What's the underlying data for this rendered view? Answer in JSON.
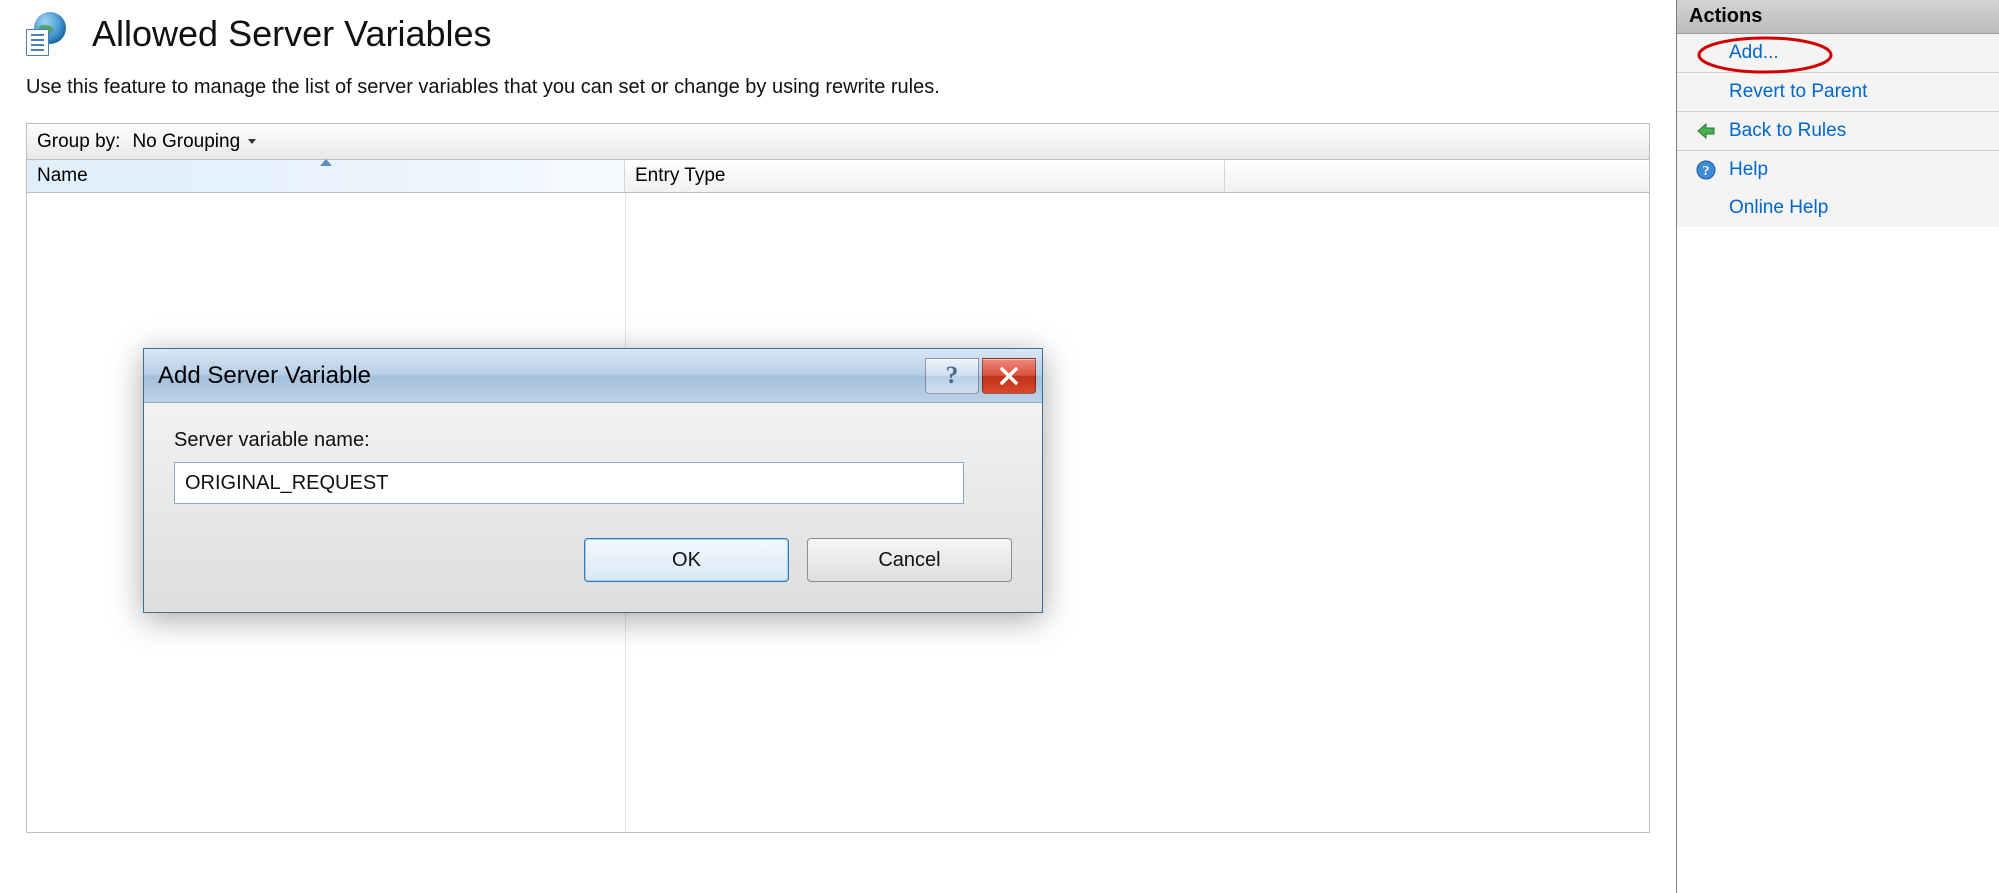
{
  "page": {
    "title": "Allowed Server Variables",
    "description": "Use this feature to manage the list of server variables that you can set or change by using rewrite rules."
  },
  "toolbar": {
    "group_by_label": "Group by:",
    "grouping_value": "No Grouping"
  },
  "columns": {
    "name": "Name",
    "entry_type": "Entry Type"
  },
  "dialog": {
    "title": "Add Server Variable",
    "field_label": "Server variable name:",
    "input_value": "ORIGINAL_REQUEST",
    "ok_label": "OK",
    "cancel_label": "Cancel",
    "help_symbol": "?"
  },
  "actions": {
    "header": "Actions",
    "add": "Add...",
    "revert": "Revert to Parent",
    "back_to_rules": "Back to Rules",
    "help": "Help",
    "online_help": "Online Help"
  }
}
